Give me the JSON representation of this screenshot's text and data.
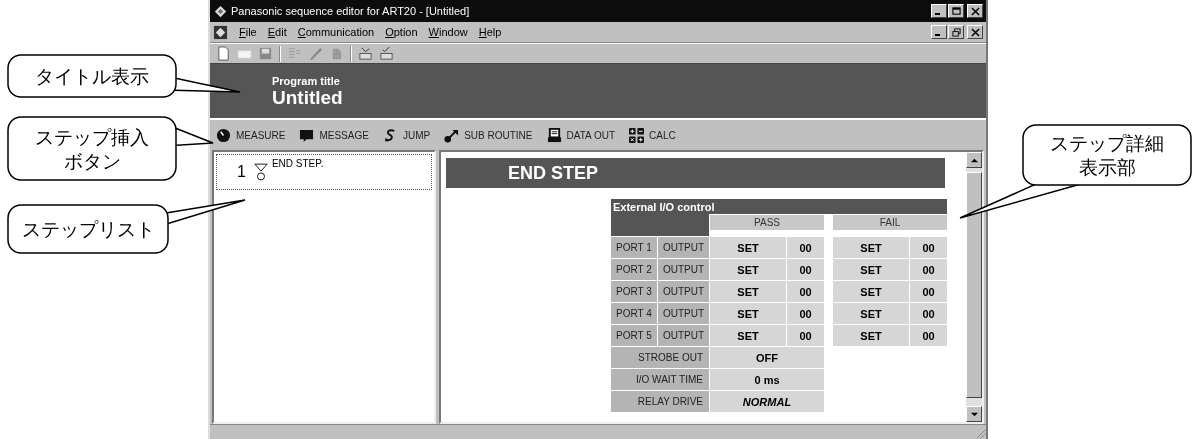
{
  "window": {
    "title": "Panasonic sequence editor for ART20 - [Untitled]"
  },
  "menu": [
    "File",
    "Edit",
    "Communication",
    "Option",
    "Window",
    "Help"
  ],
  "program_title": {
    "label": "Program title",
    "value": "Untitled"
  },
  "step_buttons": [
    {
      "label": "MEASURE",
      "kind": "measure"
    },
    {
      "label": "MESSAGE",
      "kind": "message"
    },
    {
      "label": "JUMP",
      "kind": "jump"
    },
    {
      "label": "SUB ROUTINE",
      "kind": "subroutine"
    },
    {
      "label": "DATA OUT",
      "kind": "dataout"
    },
    {
      "label": "CALC",
      "kind": "calc"
    }
  ],
  "step_list": [
    {
      "number": "1",
      "label": "END STEP.",
      "selected": true
    }
  ],
  "step_detail": {
    "heading": "END STEP",
    "io": {
      "title": "External I/O control",
      "pass_label": "PASS",
      "fail_label": "FAIL",
      "ports": [
        {
          "port": "PORT 1",
          "mode": "OUTPUT",
          "pass_action": "SET",
          "pass_value": "00",
          "fail_action": "SET",
          "fail_value": "00"
        },
        {
          "port": "PORT 2",
          "mode": "OUTPUT",
          "pass_action": "SET",
          "pass_value": "00",
          "fail_action": "SET",
          "fail_value": "00"
        },
        {
          "port": "PORT 3",
          "mode": "OUTPUT",
          "pass_action": "SET",
          "pass_value": "00",
          "fail_action": "SET",
          "fail_value": "00"
        },
        {
          "port": "PORT 4",
          "mode": "OUTPUT",
          "pass_action": "SET",
          "pass_value": "00",
          "fail_action": "SET",
          "fail_value": "00"
        },
        {
          "port": "PORT 5",
          "mode": "OUTPUT",
          "pass_action": "SET",
          "pass_value": "00",
          "fail_action": "SET",
          "fail_value": "00"
        }
      ],
      "settings": [
        {
          "label": "STROBE OUT",
          "value": "OFF",
          "italic": false
        },
        {
          "label": "I/O WAIT TIME",
          "value": "0 ms",
          "italic": false
        },
        {
          "label": "RELAY DRIVE",
          "value": "NORMAL",
          "italic": true
        }
      ]
    }
  },
  "callouts": [
    {
      "lines": [
        "タイトル表示"
      ]
    },
    {
      "lines": [
        "ステップ挿入",
        "ボタン"
      ]
    },
    {
      "lines": [
        "ステップリスト"
      ]
    },
    {
      "lines": [
        "ステップ詳細",
        "表示部"
      ]
    }
  ]
}
